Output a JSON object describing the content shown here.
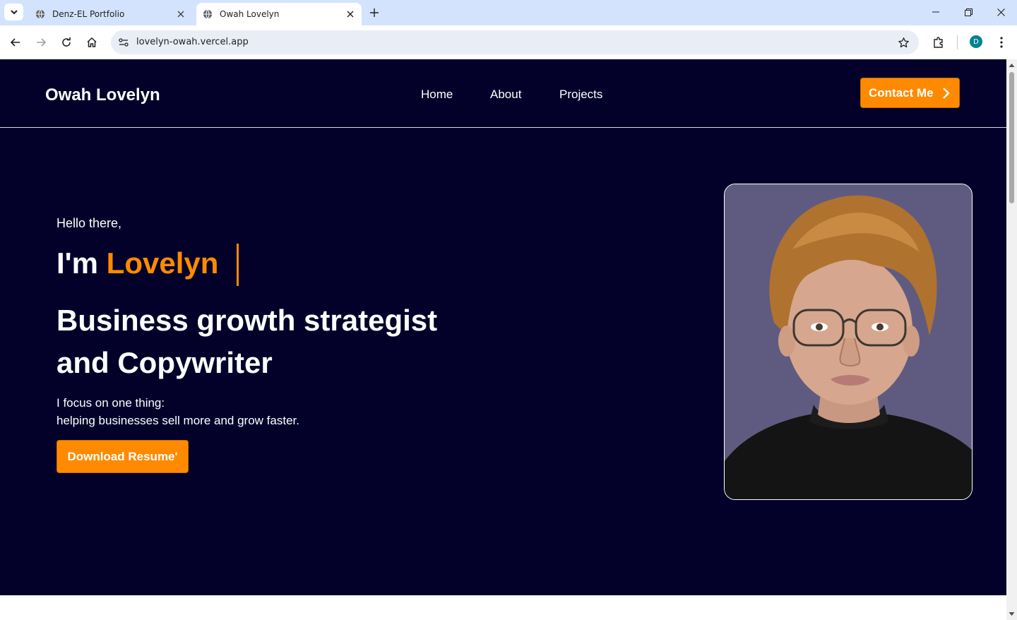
{
  "browser": {
    "tabs": [
      {
        "title": "Denz-EL Portfolio",
        "active": false
      },
      {
        "title": "Owah Lovelyn",
        "active": true
      }
    ],
    "url": "lovelyn-owah.vercel.app",
    "profile_initial": "D"
  },
  "site": {
    "brand": "Owah Lovelyn",
    "nav": [
      "Home",
      "About",
      "Projects"
    ],
    "contact_label": "Contact Me",
    "hero": {
      "greeting": "Hello there,",
      "im": "I'm ",
      "name": "Lovelyn",
      "headline_line1": "Business growth strategist",
      "headline_line2": "and Copywriter",
      "focus_line1": "I focus on one thing:",
      "focus_line2": "helping businesses sell more and grow faster.",
      "resume_label": "Download Resume'"
    }
  },
  "colors": {
    "page_background": "#03012a",
    "accent": "#ff8a00",
    "tabstrip": "#d3e3fd"
  }
}
